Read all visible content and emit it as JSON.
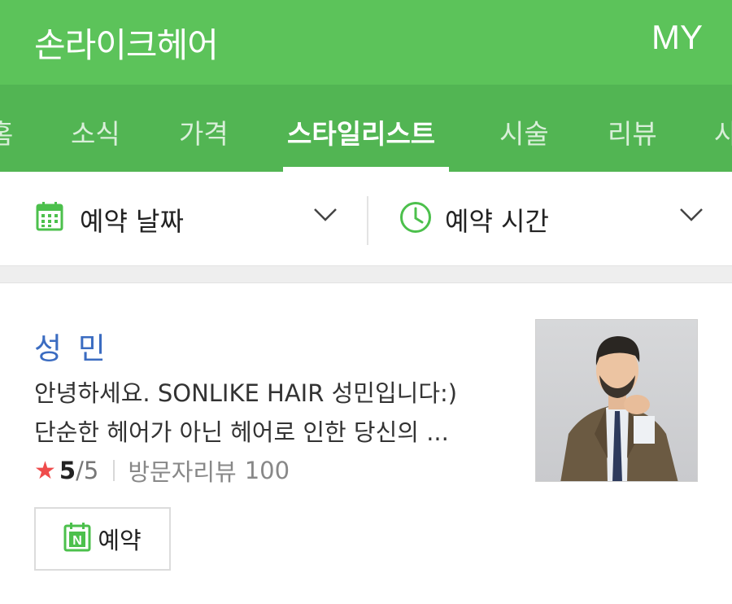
{
  "header": {
    "title": "손라이크헤어",
    "my_label": "MY"
  },
  "tabs": [
    {
      "label": "홈",
      "active": false
    },
    {
      "label": "소식",
      "active": false
    },
    {
      "label": "가격",
      "active": false
    },
    {
      "label": "스타일리스트",
      "active": true
    },
    {
      "label": "시술",
      "active": false
    },
    {
      "label": "리뷰",
      "active": false
    },
    {
      "label": "사",
      "active": false
    }
  ],
  "filters": {
    "date": {
      "label": "예약 날짜",
      "icon": "calendar-icon"
    },
    "time": {
      "label": "예약 시간",
      "icon": "clock-icon"
    }
  },
  "stylist": {
    "name": "성 민",
    "intro_line1": "안녕하세요. SONLIKE HAIR 성민입니다:)",
    "intro_line2": "단순한 헤어가 아닌 헤어로 인한 당신의 ...",
    "rating": "5",
    "rating_max": "/5",
    "review_label": "방문자리뷰",
    "review_count": "100",
    "reserve_label": "예약",
    "reserve_badge": "N"
  },
  "colors": {
    "header_green": "#5cc35a",
    "tab_green": "#52b553",
    "icon_green": "#4cc04c",
    "name_blue": "#3b6cc1",
    "star_red": "#ef4b4b"
  }
}
